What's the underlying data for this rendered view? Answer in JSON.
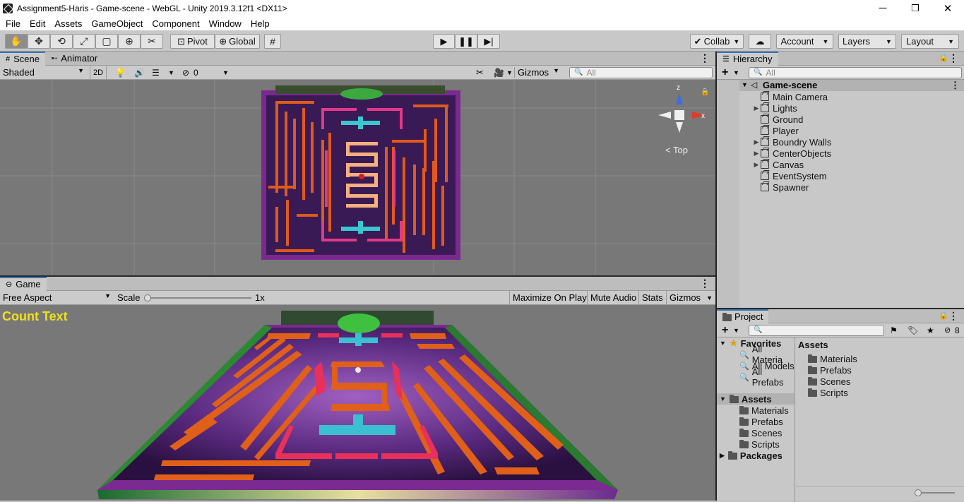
{
  "window": {
    "title": "Assignment5-Haris - Game-scene - WebGL - Unity 2019.3.12f1 <DX11>",
    "controls": [
      "─",
      "❐",
      "✕"
    ]
  },
  "menu": [
    "File",
    "Edit",
    "Assets",
    "GameObject",
    "Component",
    "Window",
    "Help"
  ],
  "toolbar": {
    "pivot": "Pivot",
    "global": "Global",
    "collab": "Collab",
    "account": "Account",
    "layers": "Layers",
    "layout": "Layout"
  },
  "scene": {
    "tabs": [
      "Scene",
      "Animator"
    ],
    "shading": "Shaded",
    "mode2d": "2D",
    "hidden_count": "0",
    "gizmos": "Gizmos",
    "search_placeholder": "All",
    "gizmo_label": "Top",
    "axis_x": "x",
    "axis_z": "z"
  },
  "game": {
    "tab": "Game",
    "aspect": "Free Aspect",
    "scale_label": "Scale",
    "scale_value": "1x",
    "buttons": [
      "Maximize On Play",
      "Mute Audio",
      "Stats",
      "Gizmos"
    ],
    "count_text": "Count Text"
  },
  "hierarchy": {
    "tab": "Hierarchy",
    "search_placeholder": "All",
    "root": "Game-scene",
    "items": [
      {
        "label": "Main Camera",
        "expandable": false
      },
      {
        "label": "Lights",
        "expandable": true
      },
      {
        "label": "Ground",
        "expandable": false
      },
      {
        "label": "Player",
        "expandable": false
      },
      {
        "label": "Boundry Walls",
        "expandable": true
      },
      {
        "label": "CenterObjects",
        "expandable": true
      },
      {
        "label": "Canvas",
        "expandable": true
      },
      {
        "label": "EventSystem",
        "expandable": false
      },
      {
        "label": "Spawner",
        "expandable": false
      }
    ]
  },
  "project": {
    "tab": "Project",
    "hidden_count": "8",
    "favorites_label": "Favorites",
    "favorites": [
      "All Materia",
      "All Models",
      "All Prefabs"
    ],
    "assets_label": "Assets",
    "asset_folders": [
      "Materials",
      "Prefabs",
      "Scenes",
      "Scripts"
    ],
    "packages_label": "Packages",
    "right_header": "Assets",
    "right_items": [
      "Materials",
      "Prefabs",
      "Scenes",
      "Scripts"
    ]
  },
  "colors": {
    "count_text": "#f0e020",
    "selection": "#3a72b0"
  }
}
